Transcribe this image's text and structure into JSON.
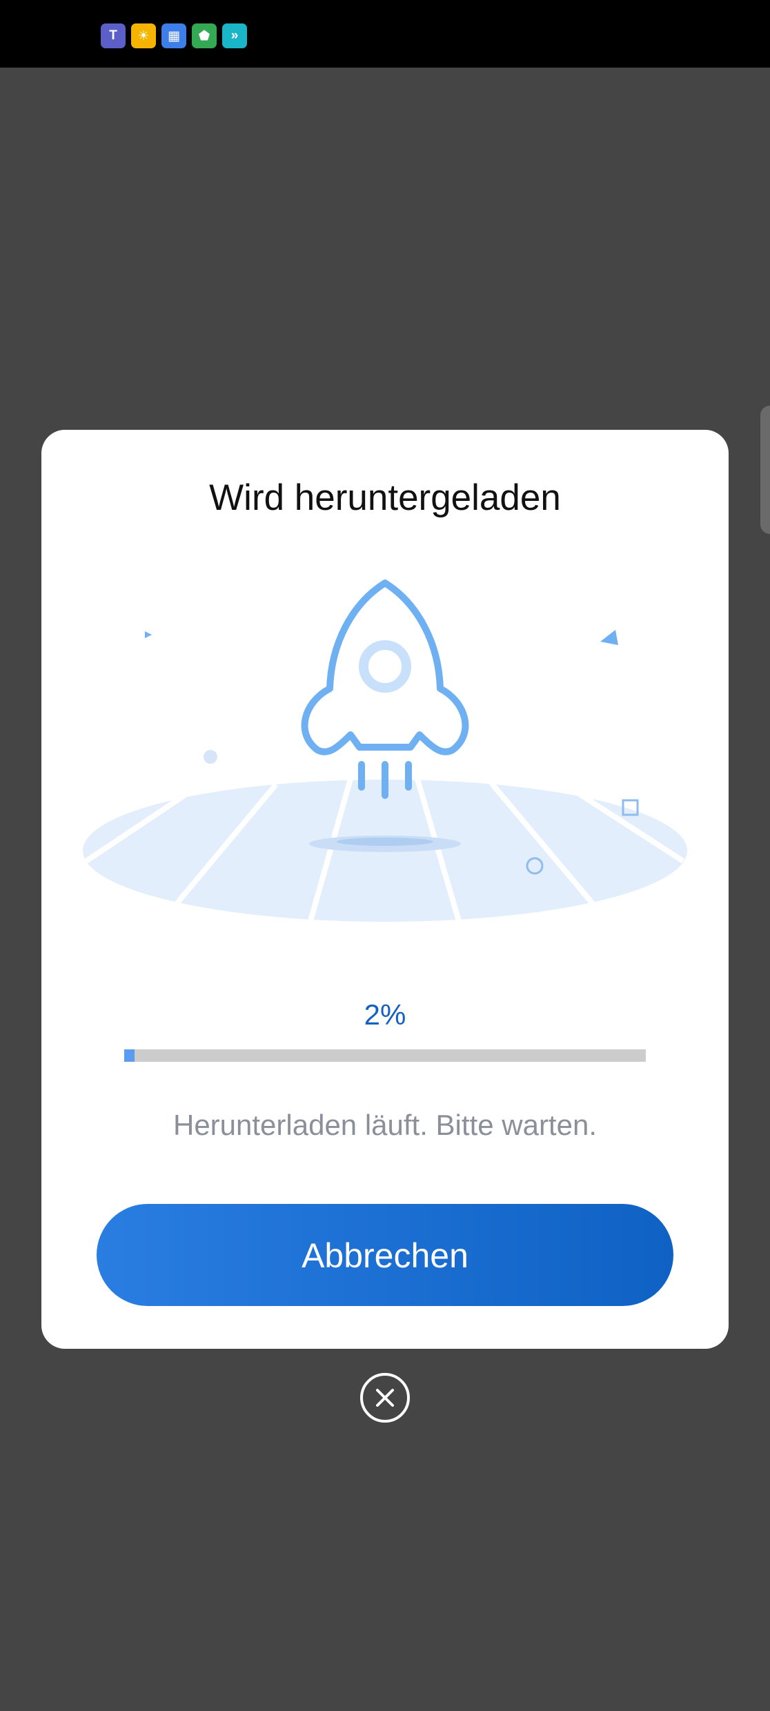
{
  "status_bar": {
    "notification_icons": [
      {
        "name": "teams-icon",
        "color": "#5b5fc7",
        "glyph": "T"
      },
      {
        "name": "sun-app-icon",
        "color": "#f4b400",
        "glyph": "☀"
      },
      {
        "name": "calendar-app-icon",
        "color": "#3d7ee8",
        "glyph": "▦"
      },
      {
        "name": "security-app-icon",
        "color": "#34a853",
        "glyph": "⬟"
      },
      {
        "name": "arrow-app-icon",
        "color": "#1ab6c8",
        "glyph": "»"
      }
    ]
  },
  "dialog": {
    "title": "Wird heruntergeladen",
    "progress_percent_label": "2%",
    "progress_value": 0.02,
    "message": "Herunterladen läuft. Bitte warten.",
    "cancel_label": "Abbrechen"
  },
  "colors": {
    "overlay": "#454545",
    "accent": "#1560c0",
    "button_start": "#2a7de1",
    "button_end": "#0f62c4",
    "progress_fill": "#5b9cf0",
    "progress_track": "#cccccc",
    "illustration_blue": "#6fb0f2",
    "illustration_light": "#e2eefc"
  },
  "close_icon": "close-circle-icon",
  "illustration_icon": "rocket-launch-illustration"
}
